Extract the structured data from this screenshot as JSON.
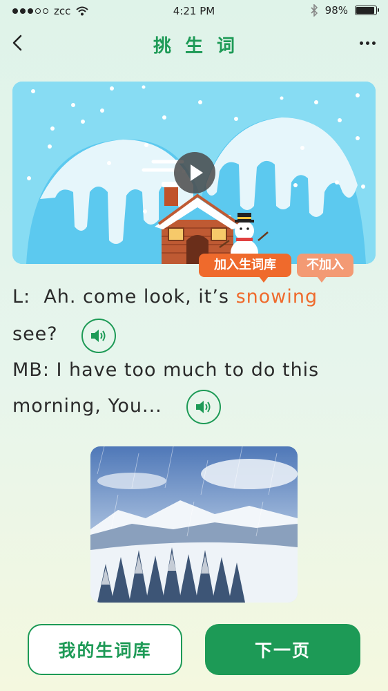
{
  "status_bar": {
    "carrier": "zcc",
    "time": "4:21 PM",
    "battery_percent": "98%",
    "battery_level": 0.98,
    "signal_dots_filled": 3,
    "signal_dots_total": 5
  },
  "header": {
    "title": "挑生词",
    "back_icon": "chevron-left-icon",
    "more_icon": "ellipsis-icon"
  },
  "banner": {
    "play_icon": "play-icon"
  },
  "word_popup": {
    "add_label": "加入生词库",
    "skip_label": "不加入"
  },
  "dialogue": [
    {
      "speaker": "L:",
      "text": "Ah. come look, it’s",
      "highlight": "snowing",
      "continuation": "see?",
      "audio_icon": "speaker-icon"
    },
    {
      "speaker": "MB:",
      "text": "I have too much to do this",
      "continuation": "morning, You...",
      "audio_icon": "speaker-icon"
    }
  ],
  "footer": {
    "my_vocab_label": "我的生词库",
    "next_page_label": "下一页"
  },
  "colors": {
    "brand_green": "#1d9a56",
    "highlight_orange": "#ef6a2c",
    "sky": "#87dcf3"
  }
}
